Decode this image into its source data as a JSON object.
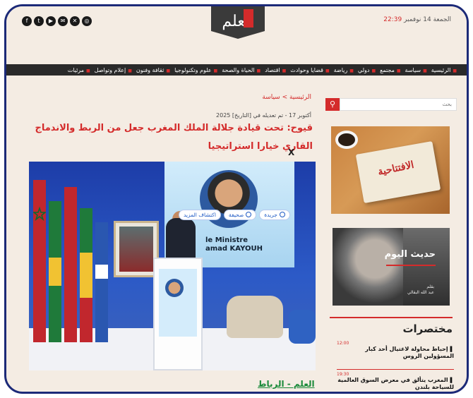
{
  "header": {
    "date": "الجمعة 14 نوفمبر",
    "time": "22:39",
    "logo_text": "العلم",
    "social_icons": [
      "facebook-icon",
      "twitter-icon",
      "youtube-icon",
      "email-icon",
      "x-icon",
      "instagram-icon"
    ]
  },
  "nav": {
    "items": [
      "الرئيسية",
      "سياسة",
      "مجتمع",
      "دولي",
      "رياضة",
      "قضايا وحوادث",
      "اقتصاد",
      "الحياة والصحة",
      "علوم وتكنولوجيا",
      "ثقافة وفنون",
      "إعلام وتواصل",
      "مرئيات"
    ]
  },
  "article": {
    "breadcrumb": "الرئيسية > سياسة",
    "dates": "أكتوبر 17 - تم تعديله في [التاريخ] 2025",
    "headline": "قيوح: تحت قيادة جلالة الملك المغرب جعل من الربط والاندماج القاري خيارا استراتيجيا",
    "close": "X",
    "caption": "العلم - الرباط"
  },
  "photo": {
    "screen_text_line1": "le Ministre",
    "screen_text_line2": "amad KAYOUH",
    "pills": [
      "جريدة",
      "صحيفة",
      "اكتشاف المزيد"
    ]
  },
  "sidebar": {
    "search_placeholder": "بحث",
    "promo1_label": "الافتتاحية",
    "promo2_title": "حديث اليوم",
    "promo2_byline_1": "بقلم",
    "promo2_byline_2": "عبد الله البقالي",
    "briefs_title": "مختصرات",
    "briefs": [
      {
        "time": "12:00",
        "text": "إحباط محاولة لاغتيال أحد كبار المسؤولين الروس"
      },
      {
        "time": "19:30",
        "text": "المغرب يتألق في معرض السوق العالمية للسياحة بلندن"
      }
    ]
  },
  "colors": {
    "accent": "#d42b2b",
    "nav_bg": "#2a2a2a",
    "frame": "#1c2a78",
    "caption": "#1a8a3a"
  }
}
